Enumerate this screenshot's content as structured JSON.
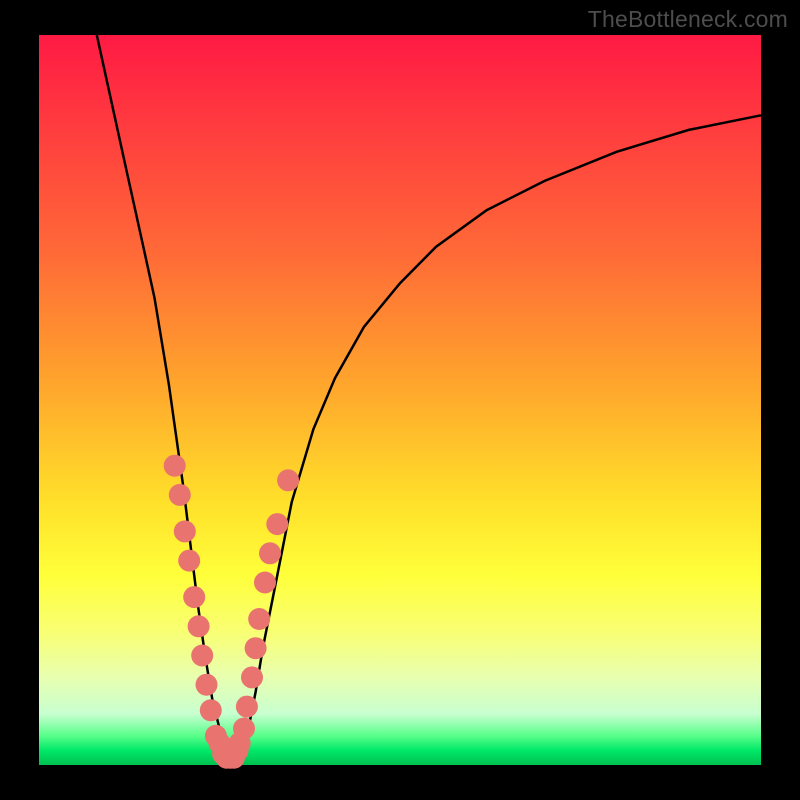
{
  "watermark": "TheBottleneck.com",
  "chart_data": {
    "type": "line",
    "title": "",
    "xlabel": "",
    "ylabel": "",
    "xlim": [
      0,
      100
    ],
    "ylim": [
      0,
      100
    ],
    "grid": false,
    "series": [
      {
        "name": "left-branch",
        "x": [
          8,
          10,
          12,
          14,
          16,
          18,
          19,
          20,
          21,
          22,
          23,
          24,
          25,
          26,
          27
        ],
        "y": [
          100,
          91,
          82,
          73,
          64,
          52,
          45,
          38,
          30,
          22,
          15,
          9,
          5,
          2,
          0
        ]
      },
      {
        "name": "right-branch",
        "x": [
          27,
          28,
          29,
          30,
          31,
          33,
          35,
          38,
          41,
          45,
          50,
          55,
          62,
          70,
          80,
          90,
          100
        ],
        "y": [
          0,
          2,
          5,
          10,
          16,
          26,
          36,
          46,
          53,
          60,
          66,
          71,
          76,
          80,
          84,
          87,
          89
        ]
      }
    ],
    "markers": [
      {
        "name": "left-cluster",
        "points": [
          {
            "x": 18.8,
            "y": 41
          },
          {
            "x": 19.5,
            "y": 37
          },
          {
            "x": 20.2,
            "y": 32
          },
          {
            "x": 20.8,
            "y": 28
          },
          {
            "x": 21.5,
            "y": 23
          },
          {
            "x": 22.1,
            "y": 19
          },
          {
            "x": 22.6,
            "y": 15
          },
          {
            "x": 23.2,
            "y": 11
          },
          {
            "x": 23.8,
            "y": 7.5
          },
          {
            "x": 25.0,
            "y": 3
          },
          {
            "x": 26.0,
            "y": 1
          }
        ]
      },
      {
        "name": "right-cluster",
        "points": [
          {
            "x": 27.0,
            "y": 1
          },
          {
            "x": 27.8,
            "y": 3
          },
          {
            "x": 28.4,
            "y": 5
          },
          {
            "x": 28.8,
            "y": 8
          },
          {
            "x": 29.5,
            "y": 12
          },
          {
            "x": 30.0,
            "y": 16
          },
          {
            "x": 30.5,
            "y": 20
          },
          {
            "x": 31.3,
            "y": 25
          },
          {
            "x": 32.0,
            "y": 29
          },
          {
            "x": 33.0,
            "y": 33
          },
          {
            "x": 34.5,
            "y": 39
          }
        ]
      },
      {
        "name": "bottom-fill",
        "points": [
          {
            "x": 24.5,
            "y": 4
          },
          {
            "x": 25.5,
            "y": 1.5
          },
          {
            "x": 26.5,
            "y": 1
          },
          {
            "x": 27.5,
            "y": 2
          }
        ]
      }
    ],
    "colors": {
      "curve": "#000000",
      "marker": "#e9746f",
      "gradient_top": "#ff1a44",
      "gradient_bottom": "#00c050"
    }
  }
}
